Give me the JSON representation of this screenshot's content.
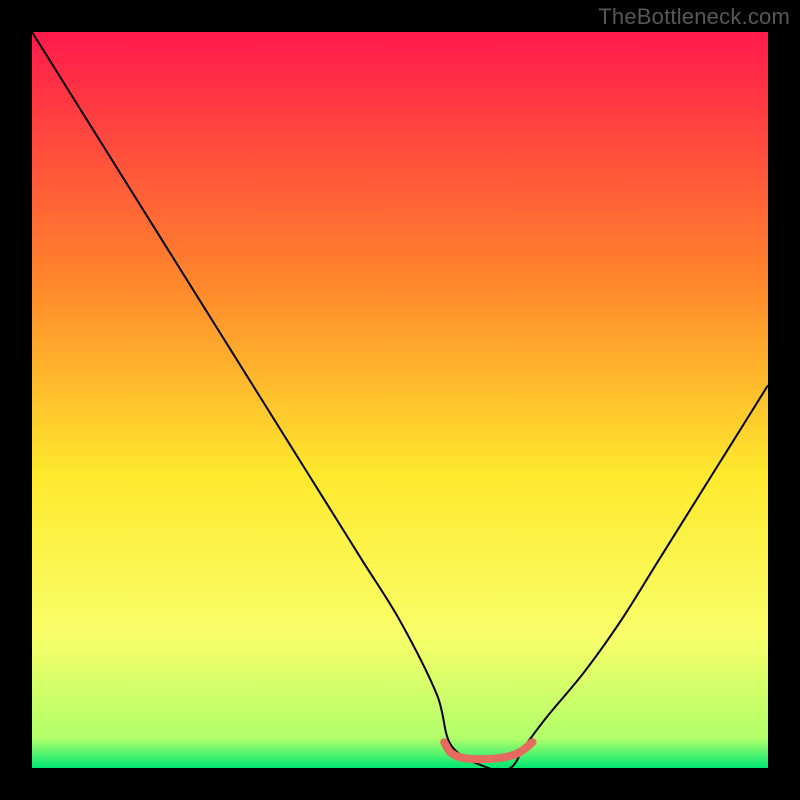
{
  "watermark": "TheBottleneck.com",
  "chart_data": {
    "type": "line",
    "title": "",
    "xlabel": "",
    "ylabel": "",
    "xlim": [
      0,
      100
    ],
    "ylim": [
      0,
      100
    ],
    "legend": false,
    "grid": false,
    "background_gradient_stops": [
      {
        "position": 0,
        "color": "#ff1a4c"
      },
      {
        "position": 35,
        "color": "#ff8a2b"
      },
      {
        "position": 60,
        "color": "#ffe92e"
      },
      {
        "position": 82,
        "color": "#f9ff6a"
      },
      {
        "position": 96,
        "color": "#b0ff6a"
      },
      {
        "position": 100,
        "color": "#00e873"
      }
    ],
    "series": [
      {
        "name": "bottleneck-curve",
        "color": "#000000",
        "stroke_width": 2,
        "x": [
          0,
          5,
          10,
          15,
          20,
          25,
          30,
          35,
          40,
          45,
          50,
          55,
          57,
          62,
          65,
          67,
          70,
          75,
          80,
          85,
          90,
          95,
          100
        ],
        "y": [
          100,
          92,
          84,
          76,
          68,
          60,
          52,
          44,
          36,
          28,
          20,
          10,
          3,
          0,
          0,
          3,
          7,
          13,
          20,
          28,
          36,
          44,
          52
        ]
      },
      {
        "name": "sweet-spot",
        "color": "#e56a5f",
        "stroke_width": 8,
        "linecap": "round",
        "x": [
          56,
          57,
          59,
          63,
          66,
          68
        ],
        "y": [
          3.5,
          2.0,
          1.3,
          1.3,
          2.0,
          3.5
        ]
      }
    ]
  }
}
